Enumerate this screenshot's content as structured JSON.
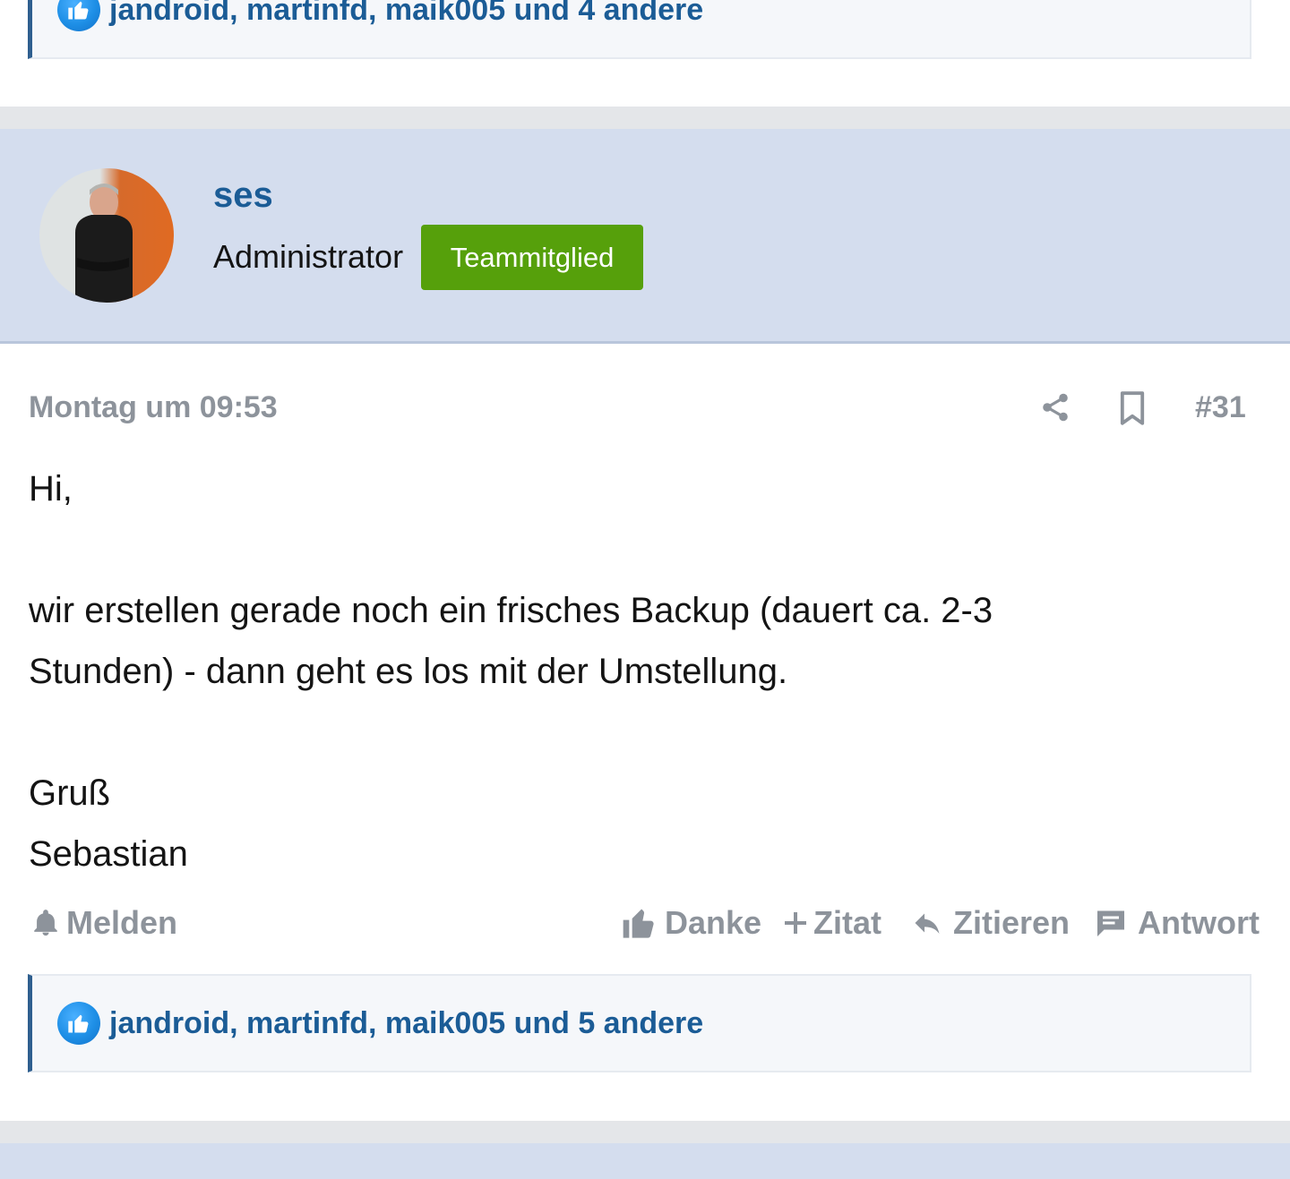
{
  "previous_post": {
    "reactions_text": "jandroid, martinfd, maik005 und 4 andere"
  },
  "post": {
    "author": {
      "name": "ses",
      "role": "Administrator",
      "badge": "Teammitglied"
    },
    "date": "Montag um 09:53",
    "number": "#31",
    "body": {
      "line1": "Hi,",
      "line2": "wir erstellen gerade noch ein frisches Backup (dauert ca. 2-3",
      "line3": "Stunden) - dann geht es los mit der Umstellung.",
      "line4": "Gruß",
      "line5": "Sebastian"
    },
    "actions": {
      "report": "Melden",
      "thanks": "Danke",
      "multiquote": "Zitat",
      "quote": "Zitieren",
      "reply": "Antwort"
    },
    "reactions_text": "jandroid, martinfd, maik005 und 5 andere"
  },
  "colors": {
    "link_blue": "#1b5c96",
    "badge_green": "#56a00b",
    "meta_gray": "#8d939b",
    "header_bg": "#d4ddee"
  },
  "icons": [
    "like-icon",
    "share-icon",
    "bookmark-icon",
    "bell-icon",
    "thumbs-up-icon",
    "plus-icon",
    "reply-icon",
    "comment-icon"
  ]
}
